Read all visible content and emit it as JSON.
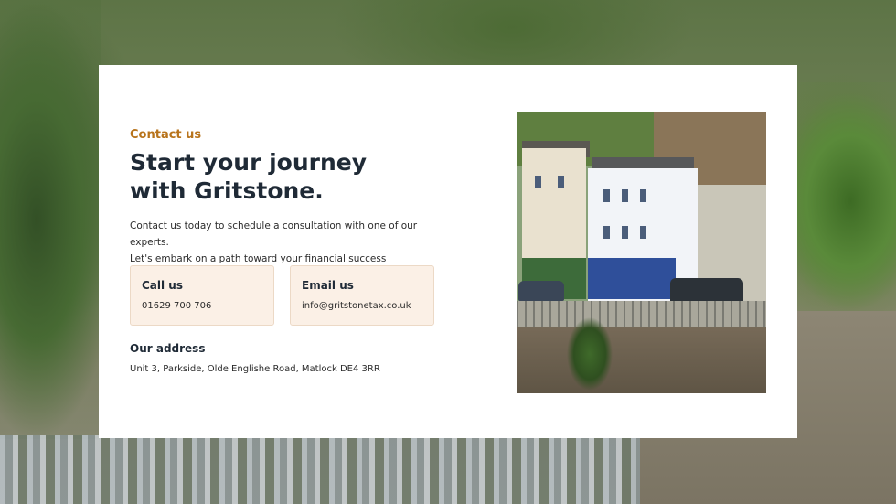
{
  "hero": {
    "eyebrow": "Contact us",
    "title": "Start your journey with Gritstone.",
    "description_line1": "Contact us today to schedule a consultation with one of our experts.",
    "description_line2": "Let's embark on a path toward your financial success together."
  },
  "contact": {
    "call": {
      "label": "Call us",
      "value": "01629 700 706"
    },
    "email": {
      "label": "Email us",
      "value": "info@gritstonetax.co.uk"
    },
    "address": {
      "label": "Our address",
      "value": "Unit 3, Parkside, Olde Englishe Road, Matlock DE4 3RR"
    }
  },
  "colors": {
    "accent": "#b8741c",
    "heading": "#1f2a36",
    "tile_background": "#fbf0e6"
  }
}
